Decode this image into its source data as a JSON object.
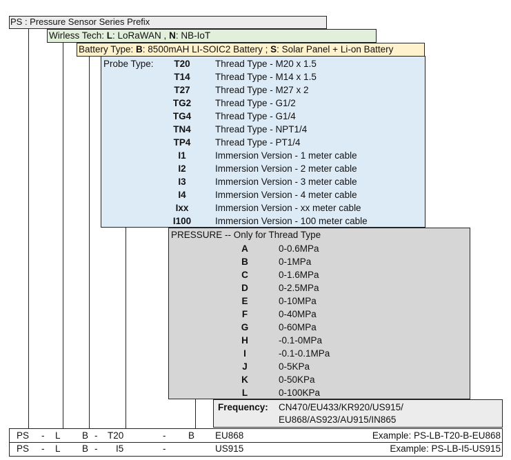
{
  "prefix": {
    "label": "PS : Pressure Sensor Series Prefix"
  },
  "wireless": {
    "label": "Wirless Tech: ",
    "opt1_key": "L",
    "opt1_text": ": LoRaWAN , ",
    "opt2_key": "N",
    "opt2_text": ": NB-IoT"
  },
  "battery": {
    "label": "Battery Type: ",
    "opt1_key": "B",
    "opt1_text": ": 8500mAH LI-SOIC2 Battery ; ",
    "opt2_key": "S",
    "opt2_text": ": Solar Panel + Li-on Battery"
  },
  "probe": {
    "label": "Probe Type:",
    "items": [
      {
        "code": "T20",
        "desc": "Thread Type - M20 x 1.5"
      },
      {
        "code": "T14",
        "desc": "Thread Type - M14 x 1.5"
      },
      {
        "code": "T27",
        "desc": "Thread Type - M27 x 2"
      },
      {
        "code": "TG2",
        "desc": "Thread Type - G1/2"
      },
      {
        "code": "TG4",
        "desc": "Thread Type - G1/4"
      },
      {
        "code": "TN4",
        "desc": "Thread Type - NPT1/4"
      },
      {
        "code": "TP4",
        "desc": "Thread Type - PT1/4"
      },
      {
        "code": "I1",
        "desc": "Immersion Version - 1 meter cable"
      },
      {
        "code": "I2",
        "desc": "Immersion Version - 2 meter cable"
      },
      {
        "code": "I3",
        "desc": "Immersion Version - 3 meter cable"
      },
      {
        "code": "I4",
        "desc": "Immersion Version - 4 meter cable"
      },
      {
        "code": "Ixx",
        "desc": "Immersion Version - xx meter cable"
      },
      {
        "code": "I100",
        "desc": "Immersion Version - 100 meter cable"
      }
    ]
  },
  "pressure": {
    "label": "PRESSURE -- Only for Thread Type",
    "items": [
      {
        "code": "A",
        "range": "0-0.6MPa"
      },
      {
        "code": "B",
        "range": "0-1MPa"
      },
      {
        "code": "C",
        "range": "0-1.6MPa"
      },
      {
        "code": "D",
        "range": "0-2.5MPa"
      },
      {
        "code": "E",
        "range": "0-10MPa"
      },
      {
        "code": "F",
        "range": "0-40MPa"
      },
      {
        "code": "G",
        "range": "0-60MPa"
      },
      {
        "code": "H",
        "range": "-0.1-0MPa"
      },
      {
        "code": "I",
        "range": "-0.1-0.1MPa"
      },
      {
        "code": "J",
        "range": "0-5KPa"
      },
      {
        "code": "K",
        "range": "0-50KPa"
      },
      {
        "code": "L",
        "range": "0-100KPa"
      }
    ]
  },
  "frequency": {
    "label": "Frequency:",
    "line1": "CN470/EU433/KR920/US915/",
    "line2": "EU868/AS923/AU915/IN865"
  },
  "examples": [
    {
      "ps": "PS",
      "d1": "-",
      "w": "L",
      "bt": "B",
      "d2": "-",
      "probe": "T20",
      "d3": "-",
      "pr": "B",
      "freq": "EU868",
      "example": "Example: PS-LB-T20-B-EU868"
    },
    {
      "ps": "PS",
      "d1": "-",
      "w": "L",
      "bt": "B",
      "d2": "-",
      "probe": "I5",
      "d3": "-",
      "pr": "",
      "freq": "US915",
      "example": "Example: PS-LB-I5-US915"
    }
  ]
}
